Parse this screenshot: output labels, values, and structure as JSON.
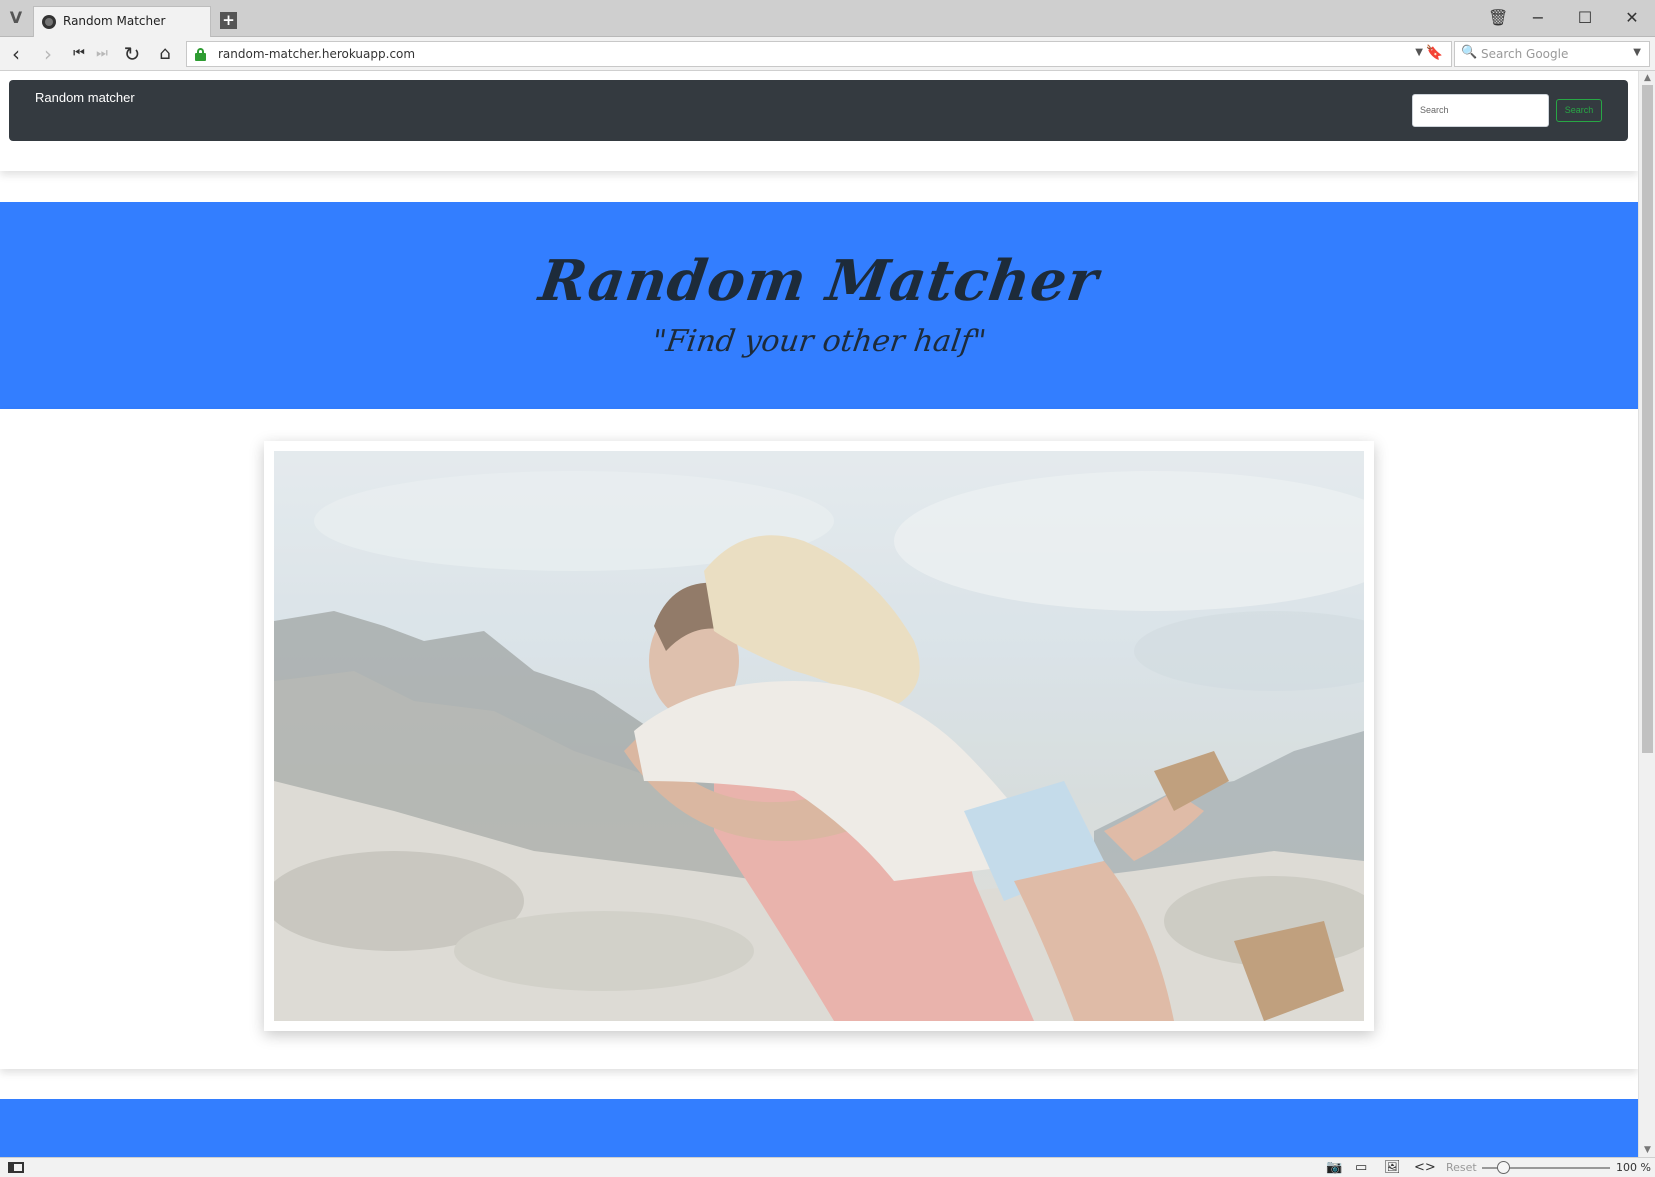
{
  "browser": {
    "tab_title": "Random Matcher",
    "new_tab_label": "+",
    "url": "random-matcher.herokuapp.com",
    "search_placeholder": "Search Google",
    "zoom_reset_label": "Reset",
    "zoom_level": "100 %"
  },
  "site": {
    "brand": "Random matcher",
    "search_placeholder": "Search",
    "search_button": "Search",
    "hero_title": "Random Matcher",
    "hero_subtitle": "\"Find your other half\"",
    "accent_color": "#337eff",
    "navbar_color": "#343a40",
    "search_button_color": "#28a745"
  },
  "icons": {
    "window": [
      "trash-icon",
      "minimize-icon",
      "maximize-icon",
      "close-icon"
    ],
    "nav": [
      "back-icon",
      "forward-icon",
      "rewind-icon",
      "fast-forward-icon",
      "reload-icon",
      "home-icon"
    ],
    "status": [
      "panel-toggle-icon",
      "camera-icon",
      "window-icon",
      "image-icon",
      "code-icon"
    ]
  }
}
